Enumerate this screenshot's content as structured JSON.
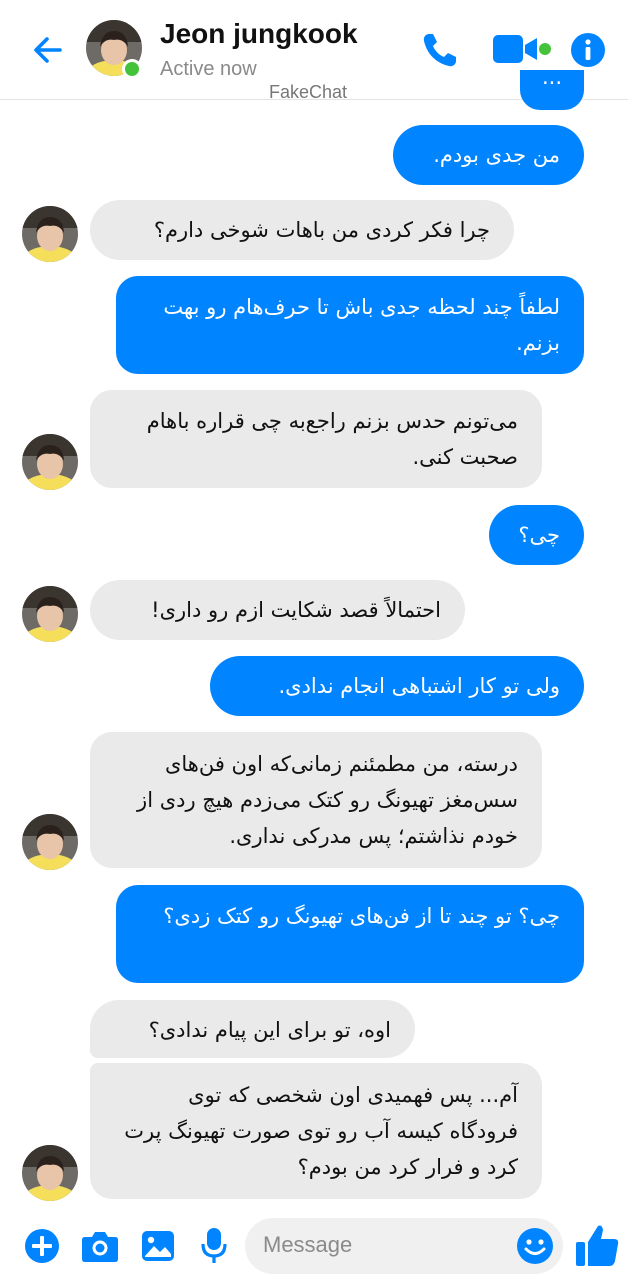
{
  "header": {
    "contact_name": "Jeon jungkook",
    "status": "Active now",
    "watermark": "FakeChat"
  },
  "colors": {
    "accent": "#0084ff",
    "sent_bubble": "#0084ff",
    "received_bubble": "#eaeaea",
    "online": "#44c23a"
  },
  "icons": {
    "back": "back-arrow-icon",
    "call": "phone-icon",
    "video": "video-camera-icon",
    "info": "info-icon",
    "add": "plus-icon",
    "camera": "camera-icon",
    "gallery": "image-icon",
    "mic": "microphone-icon",
    "emoji": "emoji-icon",
    "like": "thumbs-up-icon"
  },
  "messages": [
    {
      "sender": "me",
      "text": "..."
    },
    {
      "sender": "me",
      "text": "من جدی بودم."
    },
    {
      "sender": "contact",
      "text": "چرا فکر کردی من باهات شوخی دارم؟"
    },
    {
      "sender": "me",
      "text": "لطفاً چند لحظه جدی باش تا حرف‌هام رو بهت بزنم."
    },
    {
      "sender": "contact",
      "text": "می‌تونم حدس بزنم راجع‌به چی قراره باهام صحبت کنی."
    },
    {
      "sender": "me",
      "text": "چی؟"
    },
    {
      "sender": "contact",
      "text": "احتمالاً قصد شکایت ازم رو داری!"
    },
    {
      "sender": "me",
      "text": "ولی تو کار اشتباهی انجام ندادی."
    },
    {
      "sender": "contact",
      "text": "درسته، من مطمئنم زمانی‌که اون فن‌های سس‌مغز تهیونگ رو کتک می‌زدم هیچ ردی از خودم نذاشتم؛ پس مدرکی نداری."
    },
    {
      "sender": "me",
      "text": "چی؟ تو چند تا از فن‌های تهیونگ رو کتک زدی؟"
    },
    {
      "sender": "contact",
      "text": "اوه، تو برای این پیام ندادی؟"
    },
    {
      "sender": "contact",
      "text": "آم... پس فهمیدی اون شخصی که توی فرودگاه کیسه آب رو توی صورت تهیونگ پرت کرد و فرار کرد من بودم؟"
    }
  ],
  "composer": {
    "placeholder": "Message"
  }
}
